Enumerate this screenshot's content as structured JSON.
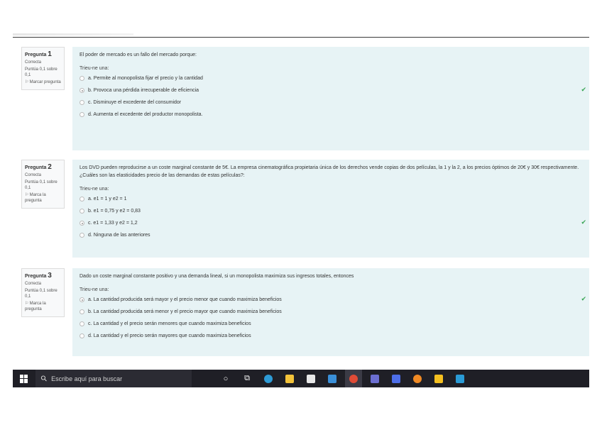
{
  "questions": [
    {
      "label": "Pregunta",
      "number": "1",
      "status": "Correcta",
      "score": "Puntúa 0,1 sobre 0,1",
      "flag": "Marcar pregunta",
      "text": "El poder de mercado es un fallo del mercado porque:",
      "prompt": "Trieu-ne una:",
      "answers": [
        {
          "text": "a. Permite al monopolista fijar el precio y la cantidad",
          "checked": false
        },
        {
          "text": "b. Provoca una pérdida irrecuperable de eficiencia",
          "checked": true
        },
        {
          "text": "c. Disminuye el excedente del consumidor",
          "checked": false
        },
        {
          "text": "d. Aumenta el excedente del productor monopolista.",
          "checked": false
        }
      ]
    },
    {
      "label": "Pregunta",
      "number": "2",
      "status": "Correcta",
      "score": "Puntúa 0,1 sobre 0,1",
      "flag": "Marca la pregunta",
      "text": "Los DVD pueden reproducirse a un coste marginal constante de 5€. La empresa cinematográfica propietaria única de los derechos vende copias de dos películas, la 1 y la 2, a los precios óptimos de 20€ y 30€ respectivamente. ¿Cuáles son las elasticidades precio de las demandas de estas películas?:",
      "prompt": "Trieu-ne una:",
      "answers": [
        {
          "text": "a. e1 = 1 y e2 = 1",
          "checked": false
        },
        {
          "text": "b. e1 = 0,75 y e2 = 0,83",
          "checked": false
        },
        {
          "text": "c. e1 = 1,33 y e2 = 1,2",
          "checked": true
        },
        {
          "text": "d. Ninguna de las anteriores",
          "checked": false
        }
      ]
    },
    {
      "label": "Pregunta",
      "number": "3",
      "status": "Correcta",
      "score": "Puntúa 0,1 sobre 0,1",
      "flag": "Marca la pregunta",
      "text": "Dado un coste marginal constante positivo y una demanda lineal, si un monopolista maximiza sus ingresos totales, entonces",
      "prompt": "Trieu-ne una:",
      "answers": [
        {
          "text": "a. La cantidad producida será mayor y el precio menor que cuando maximiza beneficios",
          "checked": true
        },
        {
          "text": "b. La cantidad producida será menor y el precio mayor que cuando maximiza beneficios",
          "checked": false
        },
        {
          "text": "c. La cantidad y el precio serán menores que cuando maximiza beneficios",
          "checked": false
        },
        {
          "text": "d. La cantidad y el precio serán mayores que cuando maximiza beneficios",
          "checked": false
        }
      ]
    }
  ],
  "taskbar": {
    "search_placeholder": "Escribe aquí para buscar",
    "icons": [
      {
        "name": "cortana-icon",
        "glyph": "○",
        "color": "#ffffff"
      },
      {
        "name": "task-view-icon",
        "glyph": "⧉",
        "color": "#ffffff"
      },
      {
        "name": "edge-icon",
        "glyph": "",
        "color": "#2e9bd6"
      },
      {
        "name": "file-explorer-icon",
        "glyph": "",
        "color": "#f3c33a"
      },
      {
        "name": "store-icon",
        "glyph": "",
        "color": "#e8e8e8"
      },
      {
        "name": "mail-icon",
        "glyph": "",
        "color": "#3a8fd8"
      },
      {
        "name": "chrome-icon",
        "glyph": "",
        "color": "#e04b36"
      },
      {
        "name": "teams-icon",
        "glyph": "",
        "color": "#6c6fd1"
      },
      {
        "name": "app-blue-icon",
        "glyph": "",
        "color": "#4d6ee8"
      },
      {
        "name": "app-orange-icon",
        "glyph": "",
        "color": "#f08a24"
      },
      {
        "name": "sticky-notes-icon",
        "glyph": "",
        "color": "#f5c020"
      },
      {
        "name": "photos-icon",
        "glyph": "",
        "color": "#2a9bd6"
      }
    ]
  }
}
